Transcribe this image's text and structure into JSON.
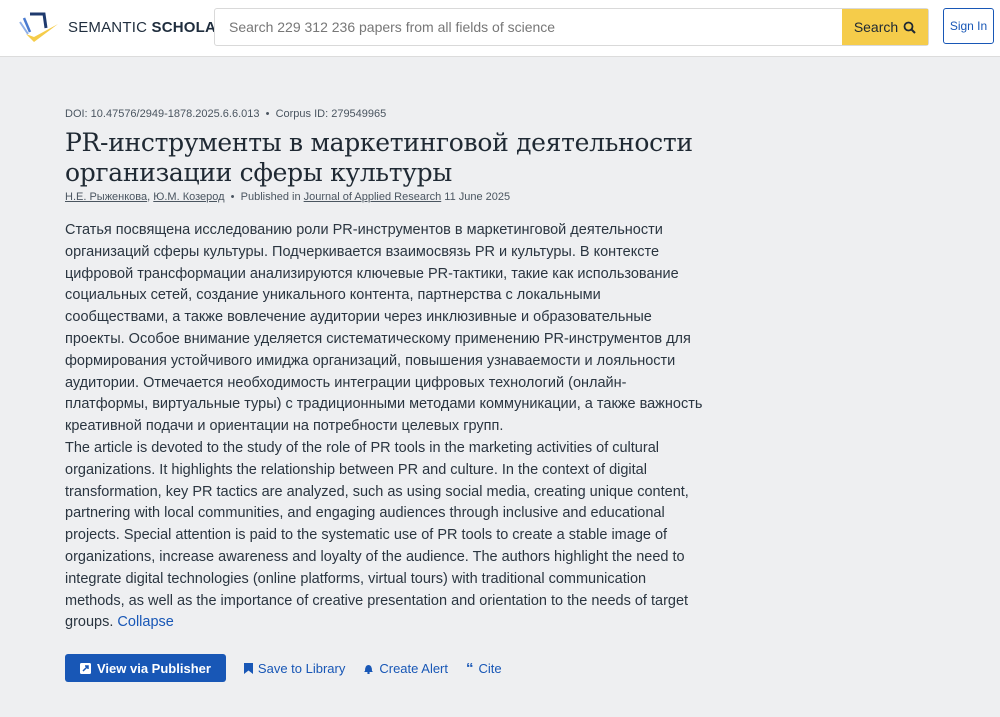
{
  "header": {
    "logo_light": "SEMANTIC ",
    "logo_bold": "SCHOLAR",
    "search_placeholder": "Search 229 312 236 papers from all fields of science",
    "search_button": "Search",
    "signin": "Sign In"
  },
  "paper": {
    "doi": "DOI: 10.47576/2949-1878.2025.6.6.013",
    "corpus_id": "Corpus ID: 279549965",
    "title": "PR-инструменты в маркетинговой деятельности организации сферы культуры",
    "authors": [
      "Н.Е. Рыженкова",
      "Ю.М. Козерод"
    ],
    "published_prefix": "Published in",
    "venue": "Journal of Applied Research",
    "date": "11 June 2025",
    "abstract_ru": "Статья посвящена исследованию роли PR-инструментов в маркетинговой деятельности организаций сферы культуры. Подчеркивается взаимосвязь PR и культуры. В контексте цифровой трансформации анализируются ключевые PR-тактики, такие как использование социальных сетей, создание уникального контента, партнерства с локальными сообществами, а также вовлечение аудитории через инклюзивные и образовательные проекты. Особое внимание уделяется систематическому применению PR-инструментов для формирования устойчивого имиджа организаций, повышения узнаваемости и лояльности аудитории. Отмечается необходимость интеграции цифровых технологий (онлайн-платформы, виртуальные туры) с традиционными методами коммуникации, а также важность креативной подачи и ориентации на потребности целевых групп.",
    "abstract_en": "The article is devoted to the study of the role of PR tools in the marketing activities of cultural organizations. It highlights the relationship between PR and culture. In the context of digital transformation, key PR tactics are analyzed, such as using social media, creating unique content, partnering with local communities, and engaging audiences through inclusive and educational projects. Special attention is paid to the systematic use of PR tools to create a stable image of organizations, increase awareness and loyalty of the audience. The authors highlight the need to integrate digital technologies (online platforms, virtual tours) with traditional communication methods, as well as the importance of creative presentation and orientation to the needs of target groups.",
    "collapse": "Collapse"
  },
  "actions": {
    "view_publisher": "View via Publisher",
    "save": "Save to Library",
    "alert": "Create Alert",
    "cite": "Cite"
  },
  "colors": {
    "accent": "#1857b6",
    "search_button": "#f5cc4a"
  }
}
